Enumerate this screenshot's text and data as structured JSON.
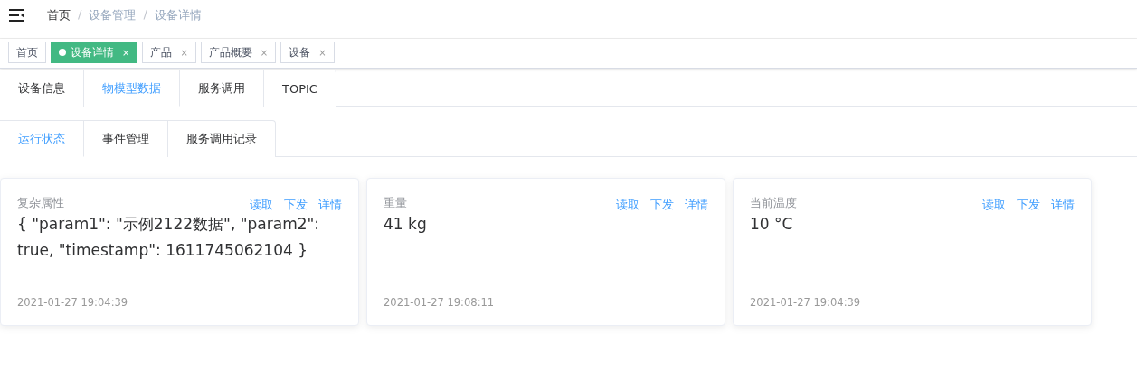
{
  "breadcrumb_separator": "/",
  "breadcrumb": [
    {
      "label": "首页",
      "current": false
    },
    {
      "label": "设备管理",
      "current": true
    },
    {
      "label": "设备详情",
      "current": true
    }
  ],
  "tags": [
    {
      "label": "首页",
      "selected": false,
      "closable": false
    },
    {
      "label": "设备详情",
      "selected": true,
      "closable": true
    },
    {
      "label": "产品",
      "selected": false,
      "closable": true
    },
    {
      "label": "产品概要",
      "selected": false,
      "closable": true
    },
    {
      "label": "设备",
      "selected": false,
      "closable": true
    }
  ],
  "close_glyph": "×",
  "tabs": [
    {
      "label": "设备信息",
      "selected": false
    },
    {
      "label": "物模型数据",
      "selected": true
    },
    {
      "label": "服务调用",
      "selected": false
    },
    {
      "label": "TOPIC",
      "selected": false
    }
  ],
  "subtabs": [
    {
      "label": "运行状态",
      "selected": true
    },
    {
      "label": "事件管理",
      "selected": false
    },
    {
      "label": "服务调用记录",
      "selected": false
    }
  ],
  "cards": [
    {
      "name": "复杂属性",
      "value": "{ \"param1\": \"示例2122数据\", \"param2\": true, \"timestamp\": 1611745062104 }",
      "time": "2021-01-27 19:04:39",
      "actions": [
        "读取",
        "下发",
        "详情"
      ]
    },
    {
      "name": "重量",
      "value": "41 kg",
      "time": "2021-01-27 19:08:11",
      "actions": [
        "读取",
        "下发",
        "详情"
      ]
    },
    {
      "name": "当前温度",
      "value": "10 °C",
      "time": "2021-01-27 19:04:39",
      "actions": [
        "读取",
        "下发",
        "详情"
      ]
    }
  ]
}
